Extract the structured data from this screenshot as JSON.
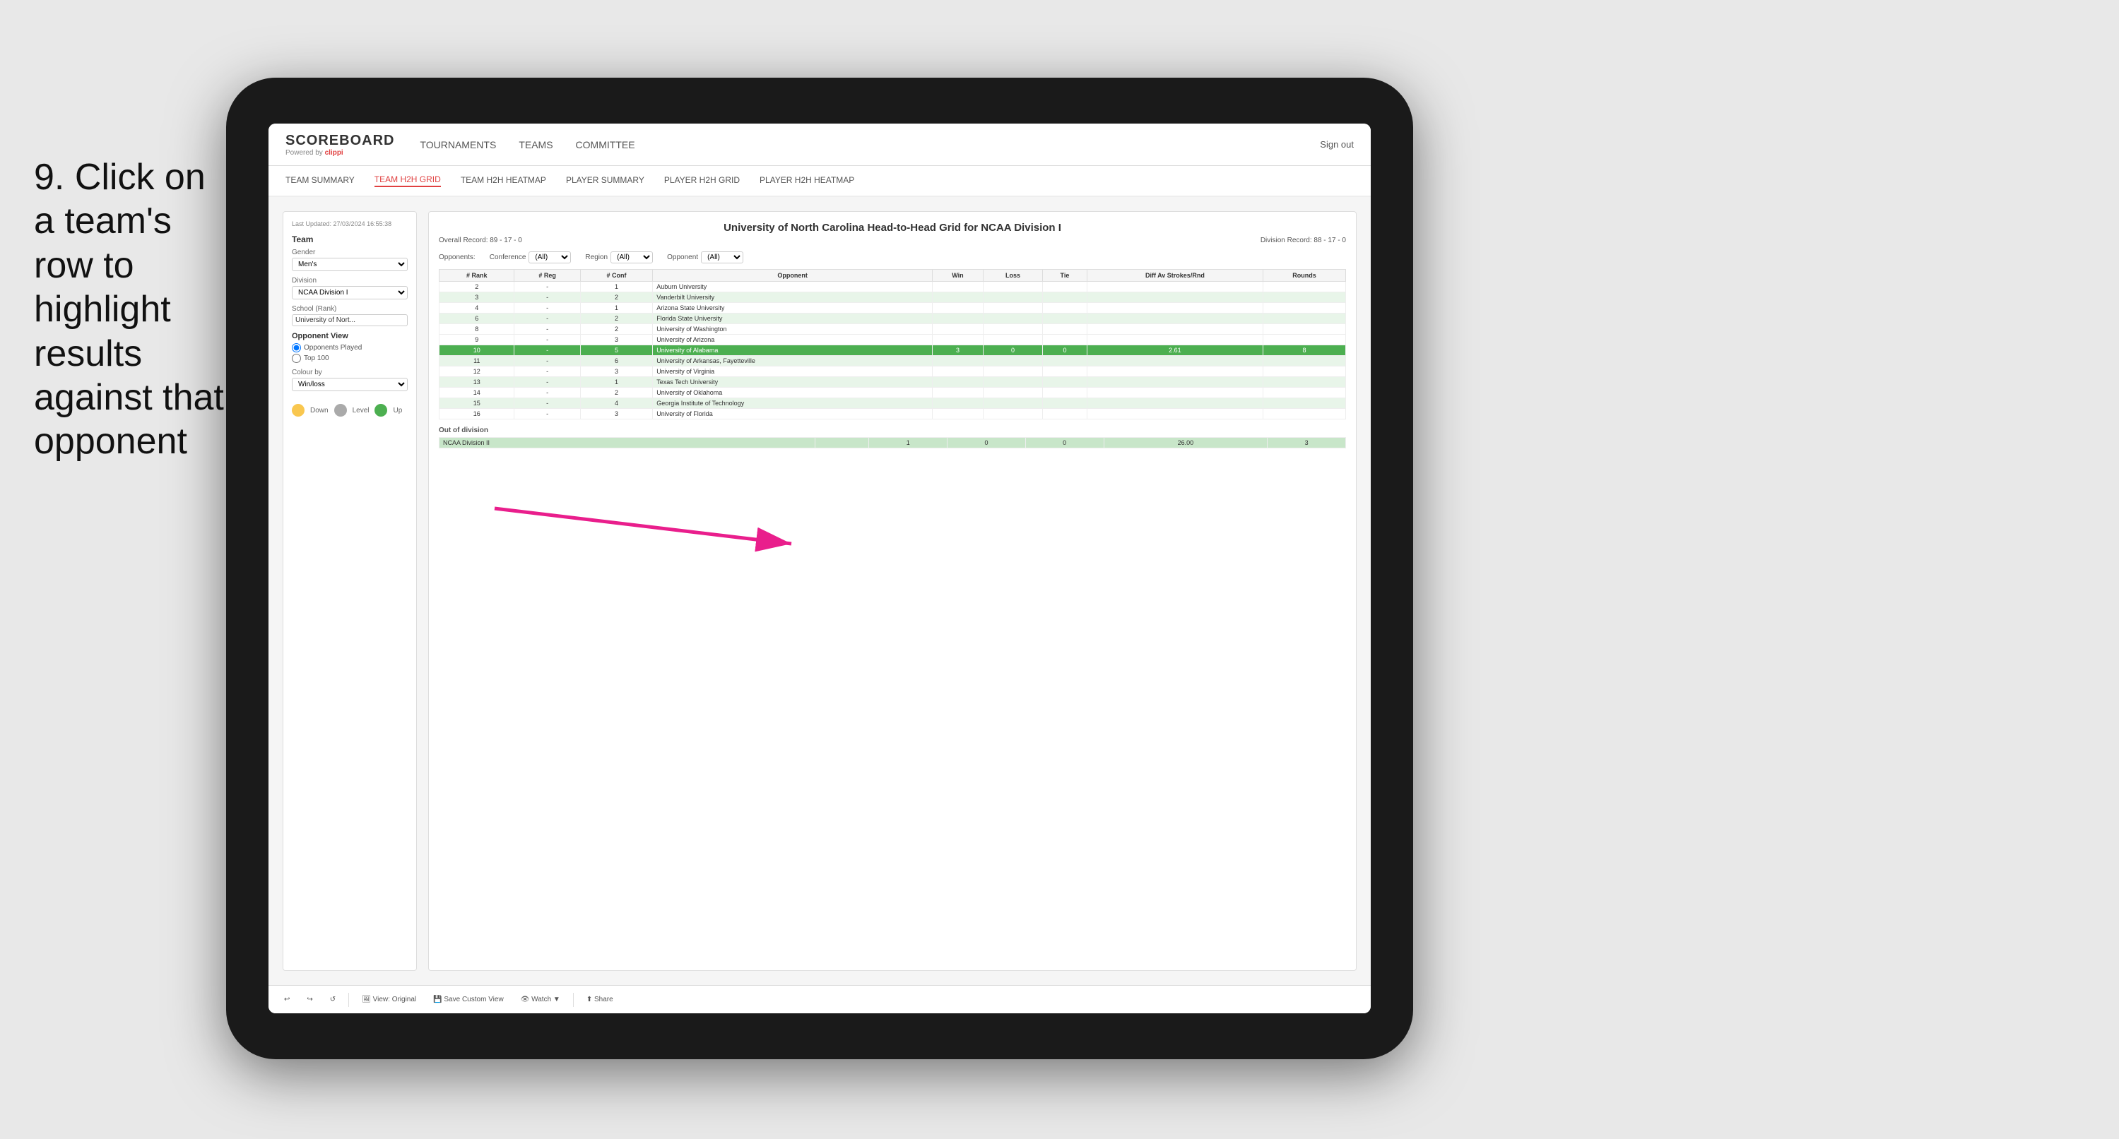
{
  "instruction": {
    "step": "9.",
    "text": "Click on a team's row to highlight results against that opponent"
  },
  "nav": {
    "logo": "SCOREBOARD",
    "powered_by": "Powered by",
    "brand": "clippi",
    "links": [
      "TOURNAMENTS",
      "TEAMS",
      "COMMITTEE"
    ],
    "sign_out": "Sign out"
  },
  "sub_nav": {
    "links": [
      "TEAM SUMMARY",
      "TEAM H2H GRID",
      "TEAM H2H HEATMAP",
      "PLAYER SUMMARY",
      "PLAYER H2H GRID",
      "PLAYER H2H HEATMAP"
    ],
    "active": "TEAM H2H GRID"
  },
  "sidebar": {
    "timestamp": "Last Updated: 27/03/2024 16:55:38",
    "team_label": "Team",
    "gender_label": "Gender",
    "gender_value": "Men's",
    "division_label": "Division",
    "division_value": "NCAA Division I",
    "school_label": "School (Rank)",
    "school_value": "University of Nort...",
    "opponent_view_title": "Opponent View",
    "radio_options": [
      "Opponents Played",
      "Top 100"
    ],
    "colour_by_label": "Colour by",
    "colour_value": "Win/loss",
    "legend": [
      {
        "label": "Down",
        "color": "#f9c74f"
      },
      {
        "label": "Level",
        "color": "#aaaaaa"
      },
      {
        "label": "Up",
        "color": "#4caf50"
      }
    ]
  },
  "grid": {
    "title": "University of North Carolina Head-to-Head Grid for NCAA Division I",
    "overall_record": "Overall Record: 89 - 17 - 0",
    "division_record": "Division Record: 88 - 17 - 0",
    "filter_conference_label": "Conference",
    "filter_conference_value": "(All)",
    "filter_region_label": "Region",
    "filter_region_value": "(All)",
    "filter_opponent_label": "Opponent",
    "filter_opponent_value": "(All)",
    "opponents_label": "Opponents:",
    "columns": [
      "# Rank",
      "# Reg",
      "# Conf",
      "Opponent",
      "Win",
      "Loss",
      "Tie",
      "Diff Av Strokes/Rnd",
      "Rounds"
    ],
    "rows": [
      {
        "rank": "2",
        "reg": "-",
        "conf": "1",
        "opponent": "Auburn University",
        "win": "",
        "loss": "",
        "tie": "",
        "diff": "",
        "rounds": "",
        "highlight": "none"
      },
      {
        "rank": "3",
        "reg": "-",
        "conf": "2",
        "opponent": "Vanderbilt University",
        "win": "",
        "loss": "",
        "tie": "",
        "diff": "",
        "rounds": "",
        "highlight": "light"
      },
      {
        "rank": "4",
        "reg": "-",
        "conf": "1",
        "opponent": "Arizona State University",
        "win": "",
        "loss": "",
        "tie": "",
        "diff": "",
        "rounds": "",
        "highlight": "none"
      },
      {
        "rank": "6",
        "reg": "-",
        "conf": "2",
        "opponent": "Florida State University",
        "win": "",
        "loss": "",
        "tie": "",
        "diff": "",
        "rounds": "",
        "highlight": "light"
      },
      {
        "rank": "8",
        "reg": "-",
        "conf": "2",
        "opponent": "University of Washington",
        "win": "",
        "loss": "",
        "tie": "",
        "diff": "",
        "rounds": "",
        "highlight": "none"
      },
      {
        "rank": "9",
        "reg": "-",
        "conf": "3",
        "opponent": "University of Arizona",
        "win": "",
        "loss": "",
        "tie": "",
        "diff": "",
        "rounds": "",
        "highlight": "none"
      },
      {
        "rank": "10",
        "reg": "-",
        "conf": "5",
        "opponent": "University of Alabama",
        "win": "3",
        "loss": "0",
        "tie": "0",
        "diff": "2.61",
        "rounds": "8",
        "highlight": "green"
      },
      {
        "rank": "11",
        "reg": "-",
        "conf": "6",
        "opponent": "University of Arkansas, Fayetteville",
        "win": "",
        "loss": "",
        "tie": "",
        "diff": "",
        "rounds": "",
        "highlight": "light"
      },
      {
        "rank": "12",
        "reg": "-",
        "conf": "3",
        "opponent": "University of Virginia",
        "win": "",
        "loss": "",
        "tie": "",
        "diff": "",
        "rounds": "",
        "highlight": "none"
      },
      {
        "rank": "13",
        "reg": "-",
        "conf": "1",
        "opponent": "Texas Tech University",
        "win": "",
        "loss": "",
        "tie": "",
        "diff": "",
        "rounds": "",
        "highlight": "light"
      },
      {
        "rank": "14",
        "reg": "-",
        "conf": "2",
        "opponent": "University of Oklahoma",
        "win": "",
        "loss": "",
        "tie": "",
        "diff": "",
        "rounds": "",
        "highlight": "none"
      },
      {
        "rank": "15",
        "reg": "-",
        "conf": "4",
        "opponent": "Georgia Institute of Technology",
        "win": "",
        "loss": "",
        "tie": "",
        "diff": "",
        "rounds": "",
        "highlight": "light"
      },
      {
        "rank": "16",
        "reg": "-",
        "conf": "3",
        "opponent": "University of Florida",
        "win": "",
        "loss": "",
        "tie": "",
        "diff": "",
        "rounds": "",
        "highlight": "none"
      }
    ],
    "out_of_division_label": "Out of division",
    "out_division_row": {
      "division": "NCAA Division II",
      "win": "1",
      "loss": "0",
      "tie": "0",
      "diff": "26.00",
      "rounds": "3"
    }
  },
  "toolbar": {
    "buttons": [
      "View: Original",
      "Save Custom View",
      "Watch ▼",
      "Share"
    ]
  }
}
